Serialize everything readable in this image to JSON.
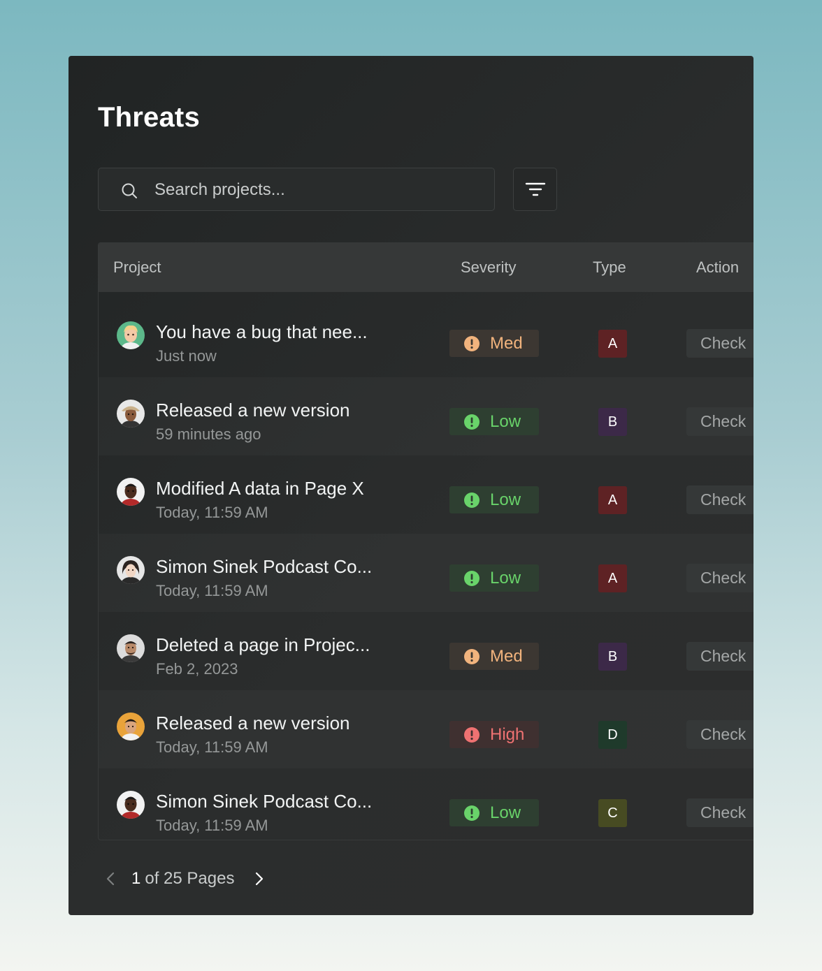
{
  "page": {
    "title": "Threats"
  },
  "search": {
    "placeholder": "Search projects...",
    "value": ""
  },
  "table": {
    "columns": {
      "project": "Project",
      "severity": "Severity",
      "type": "Type",
      "action": "Action"
    },
    "rows": [
      {
        "title": "You have a bug that nee...",
        "time": "Just now",
        "severity": "Med",
        "type": "A",
        "action": "Check"
      },
      {
        "title": "Released a new version",
        "time": "59 minutes ago",
        "severity": "Low",
        "type": "B",
        "action": "Check"
      },
      {
        "title": "Modified A data in Page X",
        "time": "Today, 11:59 AM",
        "severity": "Low",
        "type": "A",
        "action": "Check"
      },
      {
        "title": "Simon Sinek Podcast Co...",
        "time": "Today, 11:59 AM",
        "severity": "Low",
        "type": "A",
        "action": "Check"
      },
      {
        "title": "Deleted a page in Projec...",
        "time": "Feb 2, 2023",
        "severity": "Med",
        "type": "B",
        "action": "Check"
      },
      {
        "title": "Released a new version",
        "time": "Today, 11:59 AM",
        "severity": "High",
        "type": "D",
        "action": "Check"
      },
      {
        "title": "Simon Sinek Podcast Co...",
        "time": "Today, 11:59 AM",
        "severity": "Low",
        "type": "C",
        "action": "Check"
      }
    ]
  },
  "pagination": {
    "current": "1",
    "rest": "of 25 Pages"
  },
  "colors": {
    "severity_med": "#f1b37d",
    "severity_low": "#69d36a",
    "severity_high": "#ef7272",
    "type_a": "#5e2224",
    "type_b": "#3c2948",
    "type_c": "#474b22",
    "type_d": "#1f3a2b"
  },
  "icons": {
    "search": "search-icon",
    "filter": "filter-icon",
    "severity": "alert-circle-icon",
    "prev": "chevron-left-icon",
    "next": "chevron-right-icon"
  }
}
